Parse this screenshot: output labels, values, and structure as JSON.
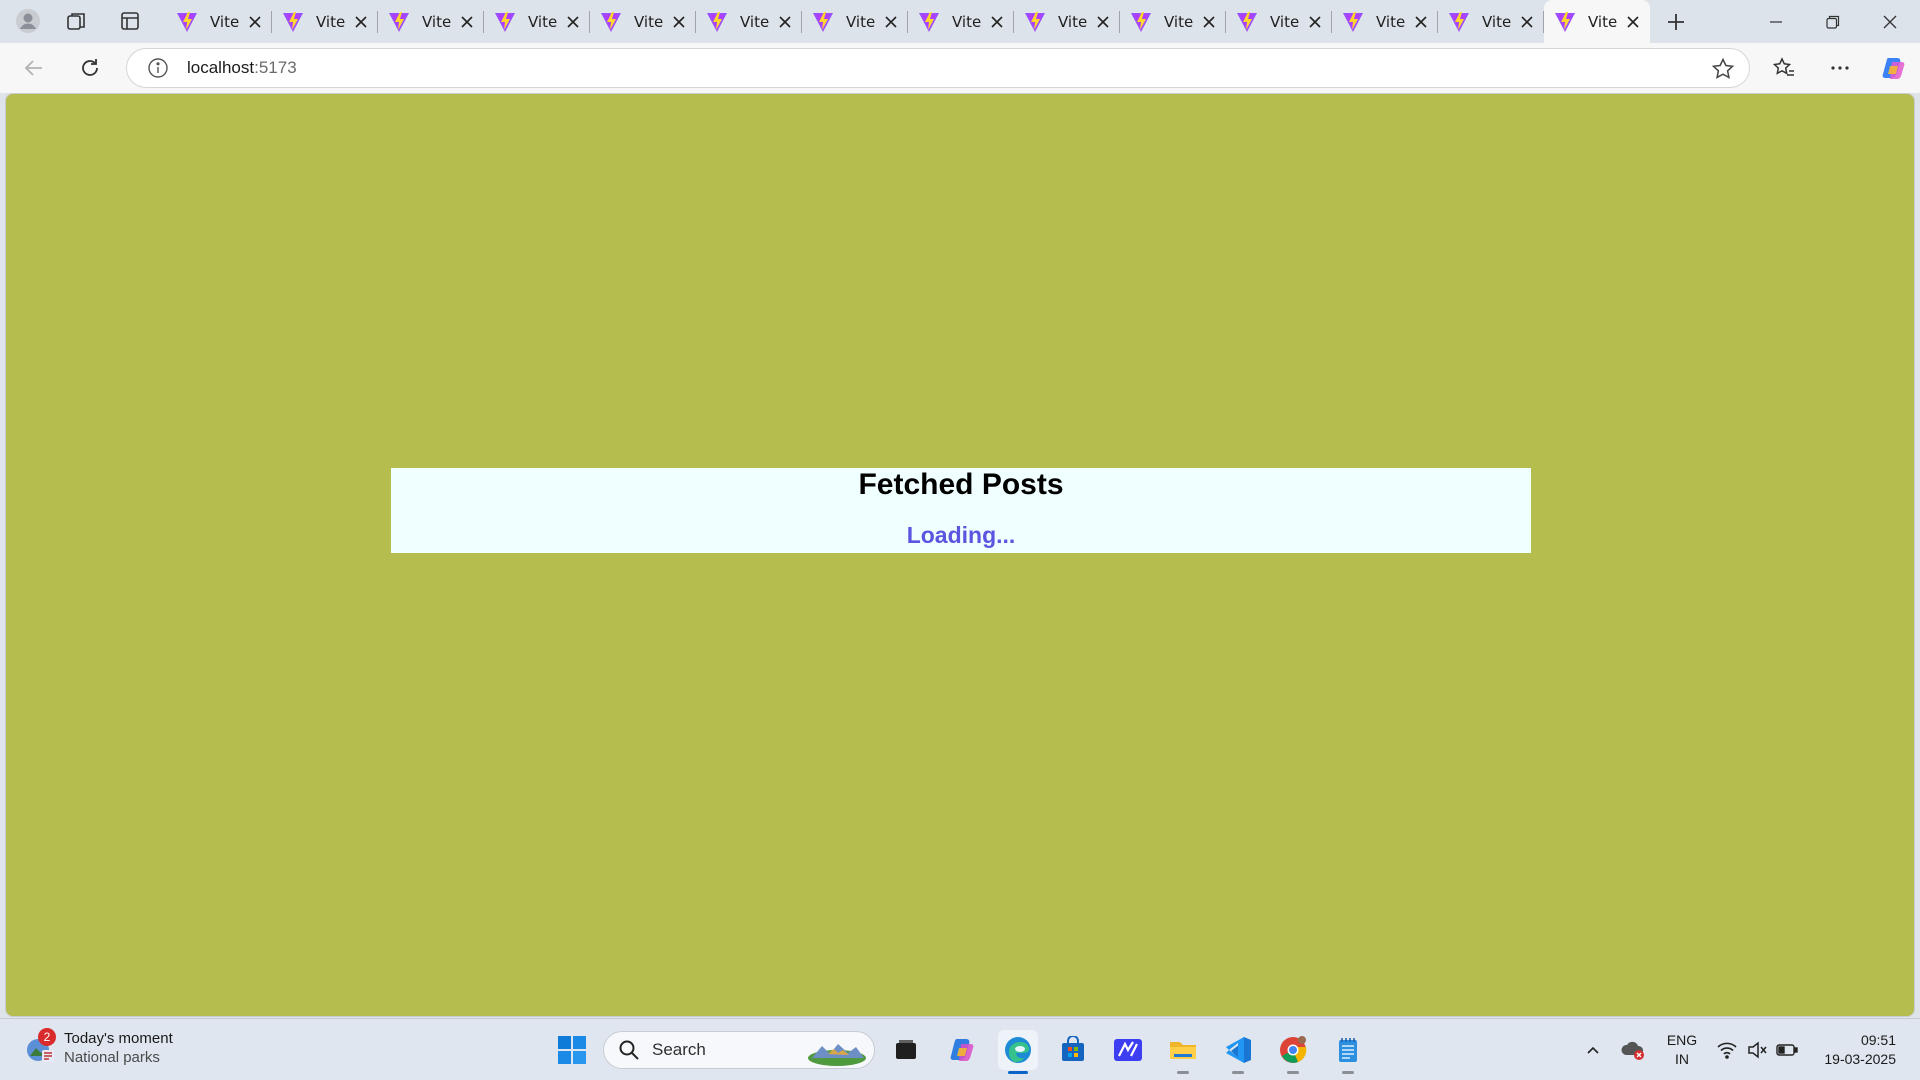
{
  "browser": {
    "tabs": [
      {
        "title": "Vite",
        "active": false
      },
      {
        "title": "Vite",
        "active": false
      },
      {
        "title": "Vite",
        "active": false
      },
      {
        "title": "Vite",
        "active": false
      },
      {
        "title": "Vite",
        "active": false
      },
      {
        "title": "Vite",
        "active": false
      },
      {
        "title": "Vite",
        "active": false
      },
      {
        "title": "Vite",
        "active": false
      },
      {
        "title": "Vite",
        "active": false
      },
      {
        "title": "Vite",
        "active": false
      },
      {
        "title": "Vite",
        "active": false
      },
      {
        "title": "Vite",
        "active": false
      },
      {
        "title": "Vite",
        "active": false
      },
      {
        "title": "Vite",
        "active": true
      }
    ],
    "url_host": "localhost",
    "url_port": ":5173",
    "tab_icon": "vite-logo-icon"
  },
  "page": {
    "background": "#b5bd4f",
    "card_background": "#f0ffff",
    "heading": "Fetched Posts",
    "status": "Loading...",
    "status_color": "#5b55e0"
  },
  "taskbar": {
    "weather_badge": "2",
    "weather_title": "Today's moment",
    "weather_subtitle": "National parks",
    "search_placeholder": "Search",
    "apps": [
      "file-explorer-icon",
      "copilot-icon",
      "edge-icon",
      "store-icon",
      "editor-icon",
      "folder-icon",
      "vscode-icon",
      "chrome-icon",
      "notepad-icon"
    ],
    "lang_line1": "ENG",
    "lang_line2": "IN",
    "time": "09:51",
    "date": "19-03-2025"
  }
}
